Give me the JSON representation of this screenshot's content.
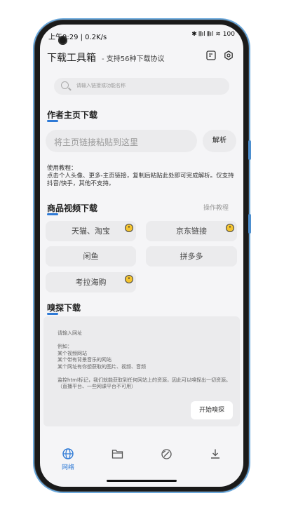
{
  "status": {
    "time_speed": "上午9:29 | 0.2K/s",
    "right": "✱ 𝄃𝄃ıl 𝄃𝄃ıl ≋ 100"
  },
  "header": {
    "title": "下载工具箱",
    "dash": "-",
    "subtitle": "支持56种下载协议"
  },
  "search": {
    "placeholder": "请输入链接或功能名称"
  },
  "author": {
    "heading": "作者主页下载",
    "placeholder": "将主页链接粘贴到这里",
    "parse": "解析",
    "tutorial": "使用教程：\n点击个人头像、更多-主页链接，复制后粘贴此处即可完成解析。仅支持抖音/快手，其他不支持。"
  },
  "goods": {
    "heading": "商品视频下载",
    "tutorial_link": "操作教程",
    "chips": [
      "天猫、淘宝",
      "京东链接",
      "闲鱼",
      "拼多多",
      "考拉海购"
    ]
  },
  "sniff": {
    "heading": "嗅探下载",
    "text": "请输入网址\n\n例如：\n某个视频网站\n某个带有背景音乐的网站\n某个网址有你想获取的图片、视频、音频\n\n监控html标记，我们就能获取到任何网站上的资源，因此可以嗅探出一切资源。（直播平台、一些网课平台不可用）",
    "button": "开始嗅探"
  },
  "nav": {
    "web_label": "网络"
  },
  "colors": {
    "accent": "#2f7ad6",
    "background": "#f5f5f7"
  }
}
